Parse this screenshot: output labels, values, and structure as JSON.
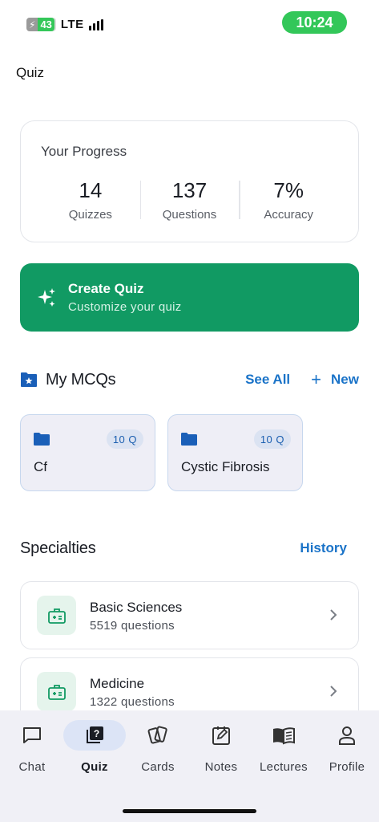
{
  "status_bar": {
    "battery_level": "43",
    "network": "LTE",
    "time": "10:24"
  },
  "page": {
    "title": "Quiz"
  },
  "progress": {
    "title": "Your Progress",
    "stats": [
      {
        "value": "14",
        "label": "Quizzes"
      },
      {
        "value": "137",
        "label": "Questions"
      },
      {
        "value": "7%",
        "label": "Accuracy"
      }
    ]
  },
  "create_quiz": {
    "title": "Create Quiz",
    "subtitle": "Customize your quiz"
  },
  "my_mcqs": {
    "title": "My MCQs",
    "see_all_label": "See All",
    "new_label": "New",
    "folders": [
      {
        "name": "Cf",
        "count": "10 Q"
      },
      {
        "name": "Cystic Fibrosis",
        "count": "10 Q"
      }
    ]
  },
  "specialties": {
    "title": "Specialties",
    "history_label": "History",
    "items": [
      {
        "name": "Basic Sciences",
        "count": "5519 questions"
      },
      {
        "name": "Medicine",
        "count": "1322 questions"
      }
    ]
  },
  "tabs": [
    {
      "label": "Chat",
      "icon": "chat-icon",
      "active": false
    },
    {
      "label": "Quiz",
      "icon": "quiz-icon",
      "active": true
    },
    {
      "label": "Cards",
      "icon": "cards-icon",
      "active": false
    },
    {
      "label": "Notes",
      "icon": "notes-icon",
      "active": false
    },
    {
      "label": "Lectures",
      "icon": "book-icon",
      "active": false
    },
    {
      "label": "Profile",
      "icon": "profile-icon",
      "active": false
    }
  ],
  "colors": {
    "accent_green": "#119a63",
    "link_blue": "#1a73c8",
    "time_pill": "#33c759"
  }
}
